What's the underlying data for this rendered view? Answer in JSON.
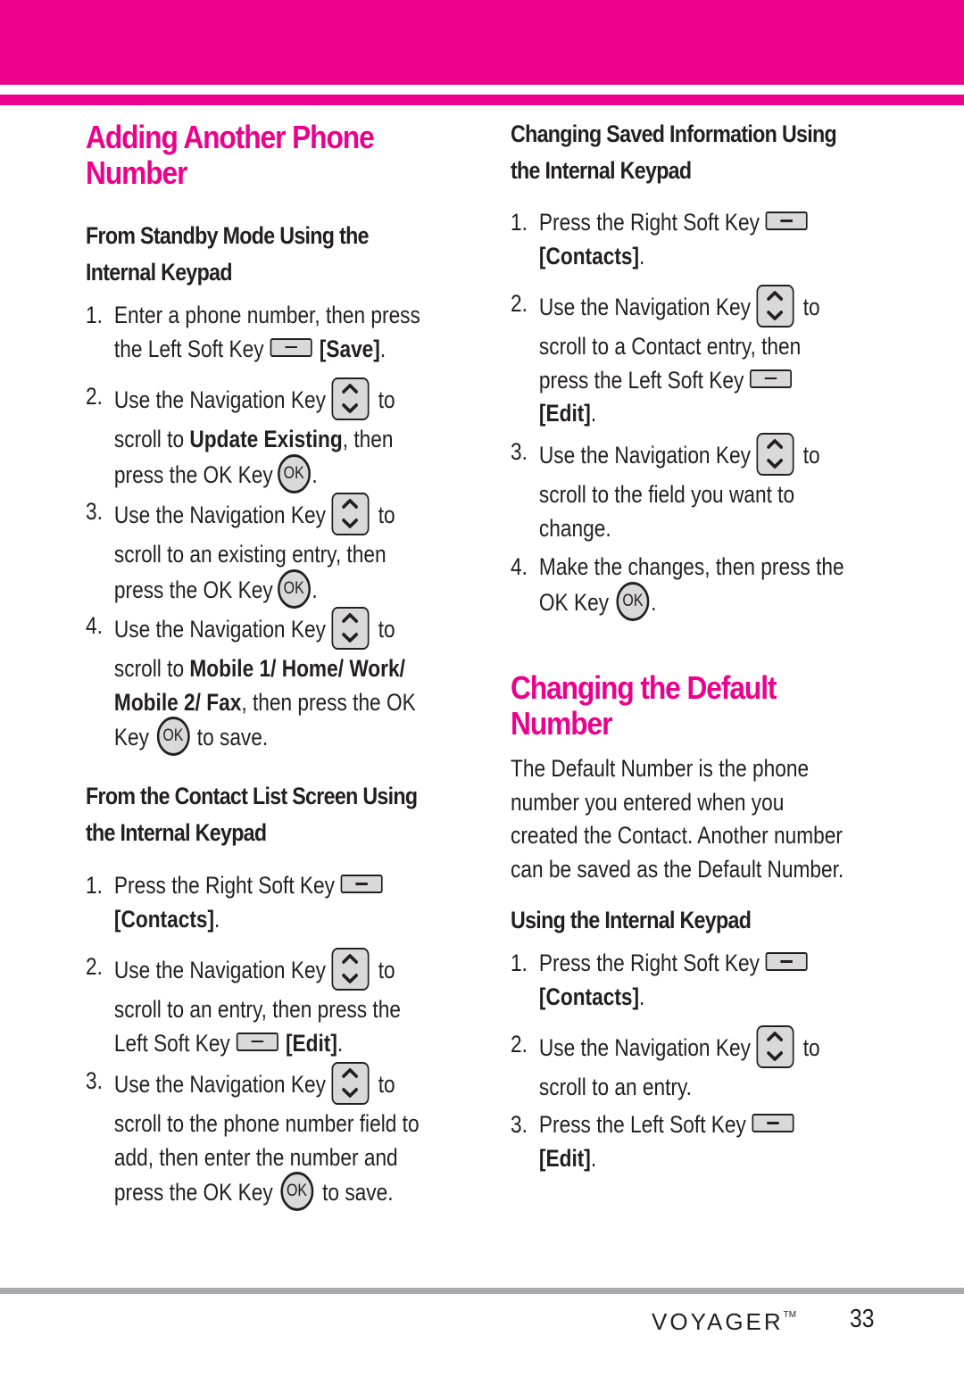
{
  "colors": {
    "accent": "#ec008c",
    "text": "#231f20",
    "footer_rule": "#a7abac",
    "key_fill": "#d9d9da"
  },
  "left": {
    "title_line1": "Adding Another Phone",
    "title_line2": "Number",
    "section1": {
      "heading_line1": "From Standby Mode Using the",
      "heading_line2": "Internal Keypad",
      "steps": [
        {
          "num": "1.",
          "l1": "Enter a phone number, then press",
          "l2a": "the Left Soft Key",
          "l2b": "[Save]",
          "l2c": "."
        },
        {
          "num": "2.",
          "l1a": "Use the Navigation Key",
          "l1b": "to",
          "l2a": "scroll to ",
          "l2b": "Update Existing",
          "l2c": ", then",
          "l3a": "press the OK Key",
          "l3b": "."
        },
        {
          "num": "3.",
          "l1a": "Use the Navigation Key",
          "l1b": "to",
          "l2": "scroll to an existing entry, then",
          "l3a": "press the OK Key",
          "l3b": "."
        },
        {
          "num": "4.",
          "l1a": "Use the Navigation Key",
          "l1b": "to",
          "l2a": "scroll to ",
          "l2b": "Mobile 1/ Home/ Work/",
          "l3a": "Mobile 2/ Fax",
          "l3b": ", then press the OK",
          "l4a": "Key",
          "l4b": "to save."
        }
      ]
    },
    "section2": {
      "heading_line1": "From the Contact List Screen Using",
      "heading_line2": "the Internal Keypad",
      "steps": [
        {
          "num": "1.",
          "l1": "Press the Right Soft Key",
          "l2a": "[Contacts]",
          "l2b": "."
        },
        {
          "num": "2.",
          "l1a": "Use the Navigation Key",
          "l1b": "to",
          "l2": "scroll to an entry, then press the",
          "l3a": "Left Soft Key",
          "l3b": "[Edit]",
          "l3c": "."
        },
        {
          "num": "3.",
          "l1a": "Use the Navigation Key",
          "l1b": "to",
          "l2": "scroll to the phone number field to",
          "l3": "add, then enter the number and",
          "l4a": "press the OK Key",
          "l4b": "to save."
        }
      ]
    }
  },
  "right": {
    "section1": {
      "heading_line1": "Changing Saved Information Using",
      "heading_line2": "the Internal Keypad",
      "steps": [
        {
          "num": "1.",
          "l1": "Press the Right Soft Key",
          "l2a": "[Contacts]",
          "l2b": "."
        },
        {
          "num": "2.",
          "l1a": "Use the Navigation Key",
          "l1b": "to",
          "l2": "scroll to a Contact entry, then",
          "l3": "press the Left Soft Key",
          "l4a": "[Edit]",
          "l4b": "."
        },
        {
          "num": "3.",
          "l1a": "Use the Navigation Key",
          "l1b": "to",
          "l2": "scroll to the field you want to",
          "l3": "change."
        },
        {
          "num": "4.",
          "l1": "Make the changes, then press the",
          "l2a": "OK Key",
          "l2b": "."
        }
      ]
    },
    "title_line1": "Changing the Default",
    "title_line2": "Number",
    "intro": [
      "The Default Number is the phone",
      "number you entered when you",
      "created the Contact. Another number",
      "can be saved as the Default Number."
    ],
    "section2": {
      "heading": "Using the Internal Keypad",
      "steps": [
        {
          "num": "1.",
          "l1": "Press the Right Soft Key",
          "l2a": "[Contacts]",
          "l2b": "."
        },
        {
          "num": "2.",
          "l1a": "Use the Navigation Key",
          "l1b": "to",
          "l2": "scroll to an entry."
        },
        {
          "num": "3.",
          "l1": "Press the Left Soft Key",
          "l2a": "[Edit]",
          "l2b": "."
        }
      ]
    }
  },
  "icons": {
    "soft_key": "soft-key-icon",
    "nav_key": "navigation-key-icon",
    "ok_key": "ok-key-icon",
    "ok_label": "OK"
  },
  "footer": {
    "brand": "VOYAGER",
    "trademark": "TM",
    "page_number": "33"
  }
}
